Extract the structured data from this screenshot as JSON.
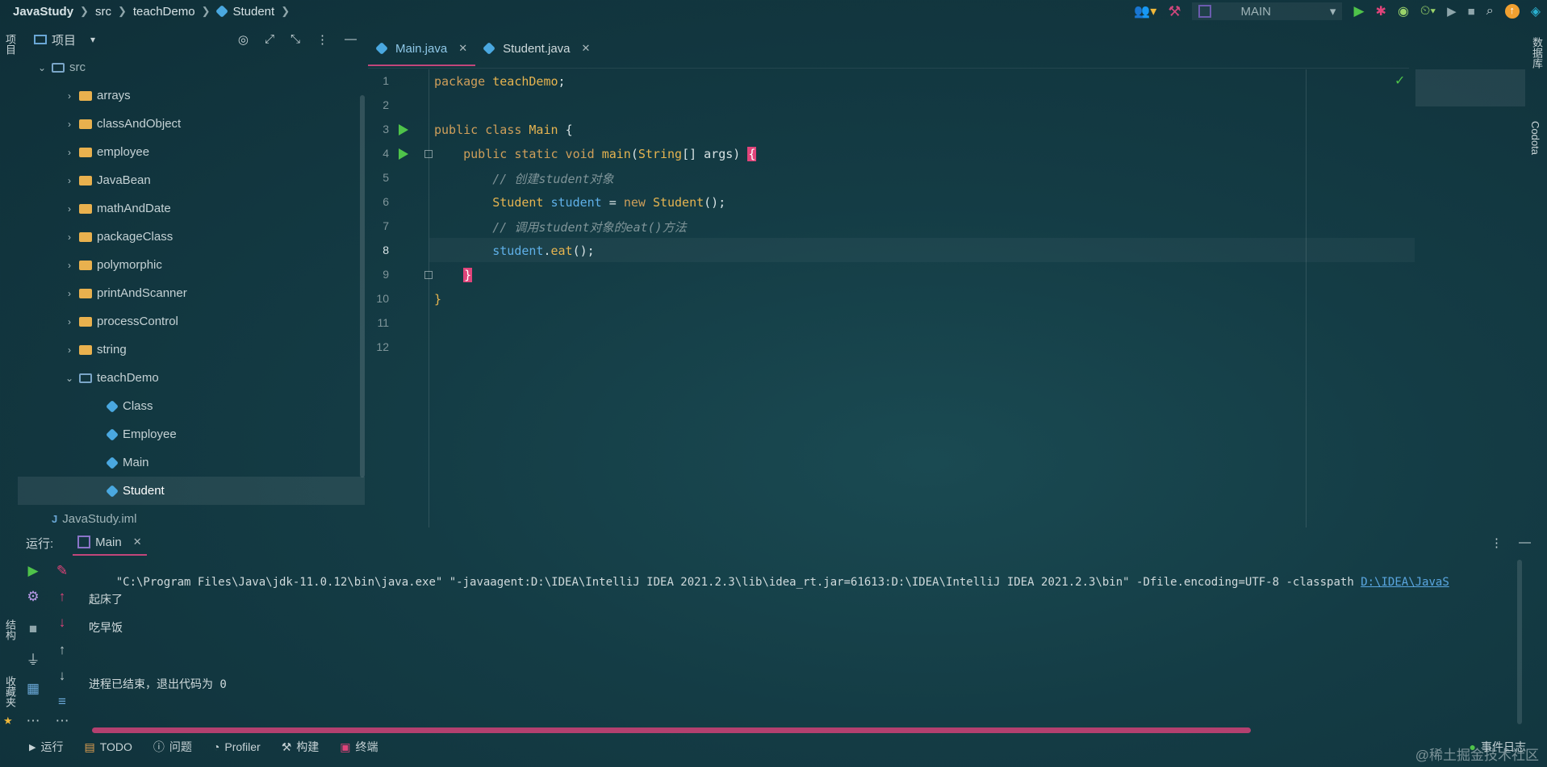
{
  "breadcrumb": [
    "JavaStudy",
    "src",
    "teachDemo",
    "Student"
  ],
  "run_config": "MAIN",
  "left_stripe": {
    "project": "项目",
    "structure": "结构",
    "favorites": "收藏夹"
  },
  "right_stripe": {
    "database": "数据库",
    "codota": "Codota"
  },
  "project_panel": {
    "title": "项目",
    "tree": [
      {
        "label": "src",
        "depth": 1,
        "kind": "src",
        "expanded": true
      },
      {
        "label": "arrays",
        "depth": 2,
        "kind": "folder"
      },
      {
        "label": "classAndObject",
        "depth": 2,
        "kind": "folder"
      },
      {
        "label": "employee",
        "depth": 2,
        "kind": "folder"
      },
      {
        "label": "JavaBean",
        "depth": 2,
        "kind": "folder"
      },
      {
        "label": "mathAndDate",
        "depth": 2,
        "kind": "folder"
      },
      {
        "label": "packageClass",
        "depth": 2,
        "kind": "folder"
      },
      {
        "label": "polymorphic",
        "depth": 2,
        "kind": "folder"
      },
      {
        "label": "printAndScanner",
        "depth": 2,
        "kind": "folder"
      },
      {
        "label": "processControl",
        "depth": 2,
        "kind": "folder"
      },
      {
        "label": "string",
        "depth": 2,
        "kind": "folder"
      },
      {
        "label": "teachDemo",
        "depth": 2,
        "kind": "package",
        "expanded": true
      },
      {
        "label": "Class",
        "depth": 3,
        "kind": "class"
      },
      {
        "label": "Employee",
        "depth": 3,
        "kind": "class"
      },
      {
        "label": "Main",
        "depth": 3,
        "kind": "class"
      },
      {
        "label": "Student",
        "depth": 3,
        "kind": "class",
        "selected": true
      },
      {
        "label": "JavaStudy.iml",
        "depth": 1,
        "kind": "iml"
      }
    ]
  },
  "tabs": [
    {
      "label": "Main.java",
      "active": true
    },
    {
      "label": "Student.java",
      "active": false
    }
  ],
  "editor": {
    "current_line": 8,
    "line_numbers": [
      "1",
      "2",
      "3",
      "4",
      "5",
      "6",
      "7",
      "8",
      "9",
      "10",
      "11",
      "12"
    ],
    "lines": [
      {
        "n": 1,
        "parts": [
          [
            "kw",
            "package "
          ],
          [
            "cn",
            "teachDemo"
          ],
          [
            "nm",
            ";"
          ]
        ]
      },
      {
        "n": 2,
        "parts": []
      },
      {
        "n": 3,
        "parts": [
          [
            "kw",
            "public class "
          ],
          [
            "cn",
            "Main "
          ],
          [
            "nm",
            "{"
          ]
        ]
      },
      {
        "n": 4,
        "parts": [
          [
            "nm",
            "    "
          ],
          [
            "kw",
            "public static void "
          ],
          [
            "cn",
            "main"
          ],
          [
            "nm",
            "("
          ],
          [
            "cn",
            "String"
          ],
          [
            "nm",
            "[] args) "
          ],
          [
            "br",
            "{"
          ]
        ]
      },
      {
        "n": 5,
        "parts": [
          [
            "nm",
            "        "
          ],
          [
            "cm",
            "// 创建student对象"
          ]
        ]
      },
      {
        "n": 6,
        "parts": [
          [
            "nm",
            "        "
          ],
          [
            "cn",
            "Student "
          ],
          [
            "vr",
            "student"
          ],
          [
            "nm",
            " = "
          ],
          [
            "kw",
            "new "
          ],
          [
            "cn",
            "Student"
          ],
          [
            "nm",
            "();"
          ]
        ]
      },
      {
        "n": 7,
        "parts": [
          [
            "nm",
            "        "
          ],
          [
            "cm",
            "// 调用student对象的eat()方法"
          ]
        ]
      },
      {
        "n": 8,
        "parts": [
          [
            "nm",
            "        "
          ],
          [
            "vr",
            "student"
          ],
          [
            "nm",
            "."
          ],
          [
            "cn",
            "eat"
          ],
          [
            "nm",
            "();"
          ]
        ]
      },
      {
        "n": 9,
        "parts": [
          [
            "nm",
            "    "
          ],
          [
            "br",
            "}"
          ]
        ]
      },
      {
        "n": 10,
        "parts": [
          [
            "cn",
            "}"
          ]
        ]
      },
      {
        "n": 11,
        "parts": []
      },
      {
        "n": 12,
        "parts": []
      }
    ]
  },
  "run_panel": {
    "label": "运行:",
    "tab": "Main",
    "console_cmd": "\"C:\\Program Files\\Java\\jdk-11.0.12\\bin\\java.exe\" \"-javaagent:D:\\IDEA\\IntelliJ IDEA 2021.2.3\\lib\\idea_rt.jar=61613:D:\\IDEA\\IntelliJ IDEA 2021.2.3\\bin\" -Dfile.encoding=UTF-8 -classpath ",
    "console_link": "D:\\IDEA\\JavaS",
    "output": [
      "起床了",
      "吃早饭",
      "",
      "进程已结束，退出代码为 0"
    ]
  },
  "status_bar": {
    "run": "运行",
    "todo": "TODO",
    "problems": "问题",
    "profiler": "Profiler",
    "build": "构建",
    "terminal": "终端",
    "event_log": "事件日志"
  },
  "watermark": "@稀土掘金技术社区",
  "colors": {
    "accent": "#c2467a",
    "run_green": "#4fc34a",
    "folder": "#e9b14e"
  }
}
